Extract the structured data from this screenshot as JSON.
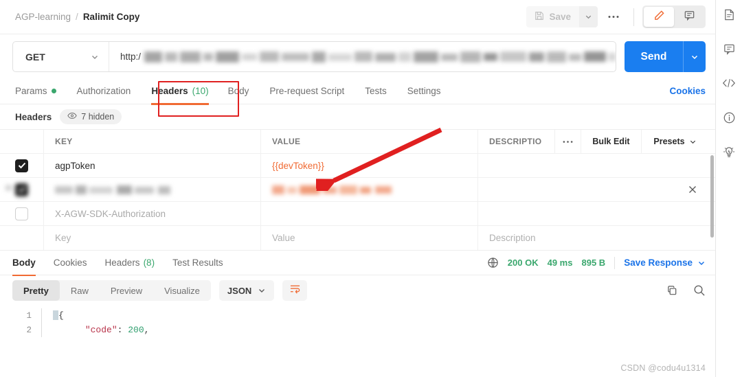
{
  "breadcrumb": {
    "root": "AGP-learning",
    "separator": "/",
    "leaf": "Ralimit Copy"
  },
  "toolbar": {
    "save_label": "Save",
    "save_icon": "floppy-disk-icon",
    "more_label": "●●●",
    "edit_icon": "pencil-icon",
    "comment_icon": "comment-icon"
  },
  "request": {
    "method": "GET",
    "url_prefix": "http:/",
    "url_redacted": true,
    "send_label": "Send"
  },
  "request_tabs": [
    {
      "label": "Params",
      "active": false,
      "dot": true
    },
    {
      "label": "Authorization",
      "active": false,
      "dot": false
    },
    {
      "label": "Headers",
      "count": "(10)",
      "active": true,
      "dot": false
    },
    {
      "label": "Body",
      "active": false,
      "dot": false
    },
    {
      "label": "Pre-request Script",
      "active": false,
      "dot": false
    },
    {
      "label": "Tests",
      "active": false,
      "dot": false
    },
    {
      "label": "Settings",
      "active": false,
      "dot": false
    }
  ],
  "cookies_link": "Cookies",
  "headers_panel": {
    "title": "Headers",
    "hidden_pill": "7 hidden",
    "eye_icon": "eye-icon"
  },
  "headers_table": {
    "columns": {
      "key": "KEY",
      "value": "VALUE",
      "description": "DESCRIPTIO"
    },
    "tools": {
      "dots": "●●●",
      "bulk_edit": "Bulk Edit",
      "presets": "Presets"
    },
    "rows": [
      {
        "checked": true,
        "key": "agpToken",
        "value": "{{devToken}}",
        "value_is_variable": true,
        "description": "",
        "blurred": false,
        "has_delete": false
      },
      {
        "checked": true,
        "key": "",
        "value": "",
        "description": "",
        "blurred": true,
        "has_delete": true
      },
      {
        "checked": false,
        "key": "X-AGW-SDK-Authorization",
        "key_dim": true,
        "value": "",
        "description": "",
        "blurred": false,
        "has_delete": false
      },
      {
        "checked": null,
        "key": "Key",
        "key_placeholder": true,
        "value": "Value",
        "value_placeholder": true,
        "description": "Description",
        "desc_placeholder": true,
        "blurred": false,
        "has_delete": false
      }
    ]
  },
  "response_tabs": [
    {
      "label": "Body",
      "active": true
    },
    {
      "label": "Cookies",
      "active": false
    },
    {
      "label": "Headers",
      "count": "(8)",
      "active": false
    },
    {
      "label": "Test Results",
      "active": false
    }
  ],
  "response_meta": {
    "globe_icon": "globe-icon",
    "status": "200 OK",
    "time": "49 ms",
    "size": "895 B",
    "save_response": "Save Response"
  },
  "viewer": {
    "modes": [
      {
        "label": "Pretty",
        "active": true
      },
      {
        "label": "Raw",
        "active": false
      },
      {
        "label": "Preview",
        "active": false
      },
      {
        "label": "Visualize",
        "active": false
      }
    ],
    "format": "JSON",
    "wrap_icon": "wrap-text-icon",
    "copy_icon": "copy-icon",
    "search_icon": "search-icon"
  },
  "code_body": {
    "lines": [
      {
        "num": "1",
        "brace": "{"
      },
      {
        "num": "2",
        "key": "\"code\"",
        "colon": ": ",
        "num_val": "200",
        "comma": ","
      }
    ]
  },
  "right_rail": [
    {
      "name": "documentation-icon"
    },
    {
      "name": "comment-icon"
    },
    {
      "name": "code-icon"
    },
    {
      "name": "info-icon"
    },
    {
      "name": "lightbulb-icon"
    }
  ],
  "watermark": "CSDN @codu4u1314",
  "colors": {
    "accent_orange": "#f06a33",
    "link_blue": "#1a73e8",
    "send_blue": "#1a7ef0",
    "status_green": "#3aa76d",
    "annotation_red": "#e02020"
  }
}
